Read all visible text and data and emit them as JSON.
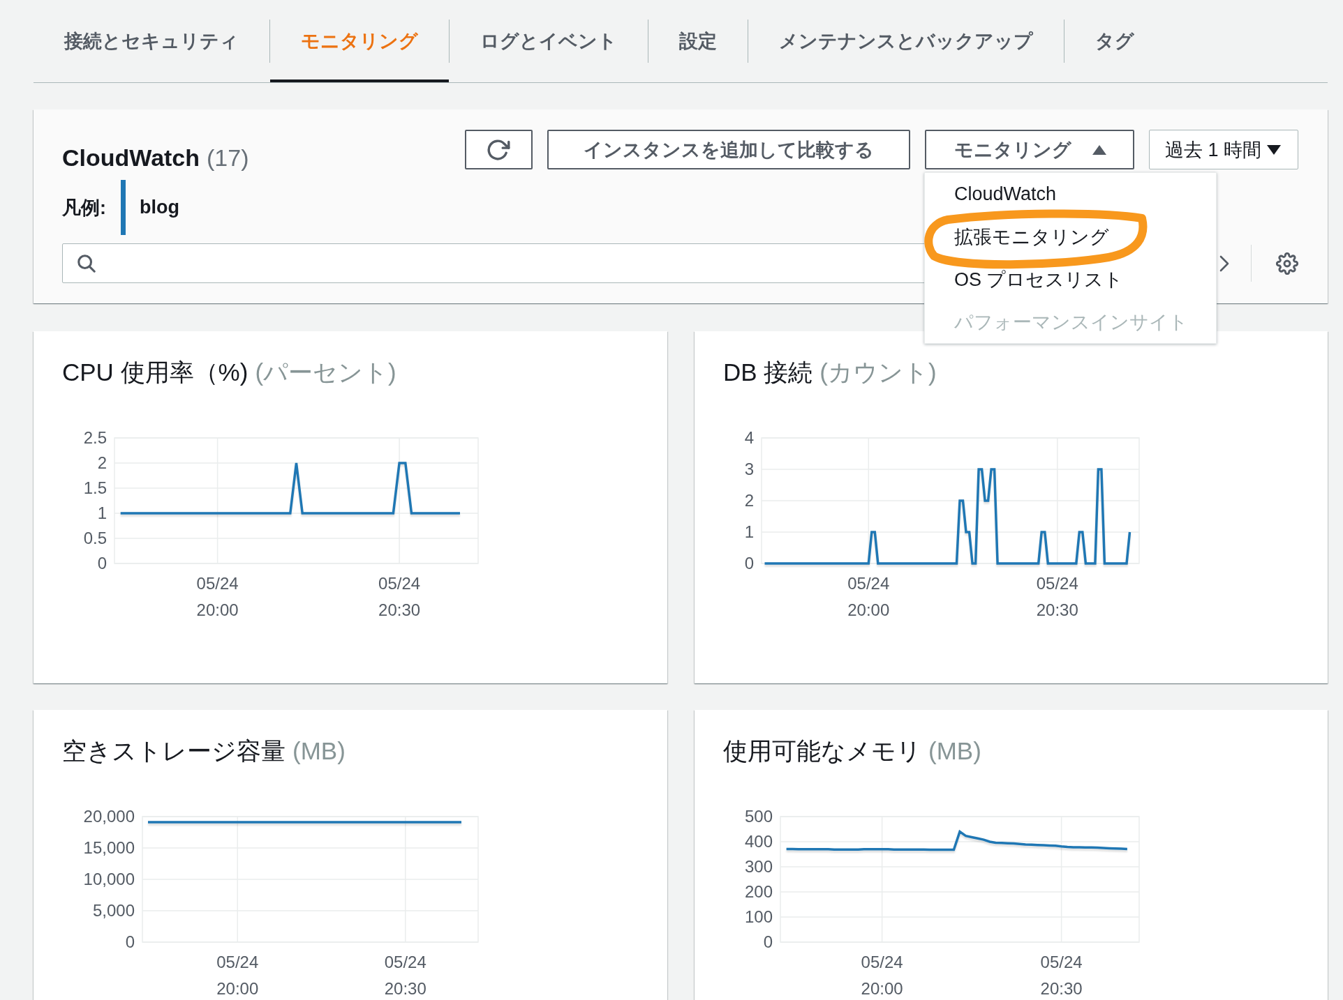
{
  "tabs": [
    {
      "label": "接続とセキュリティ",
      "selected": false
    },
    {
      "label": "モニタリング",
      "selected": true
    },
    {
      "label": "ログとイベント",
      "selected": false
    },
    {
      "label": "設定",
      "selected": false
    },
    {
      "label": "メンテナンスとバックアップ",
      "selected": false
    },
    {
      "label": "タグ",
      "selected": false
    }
  ],
  "cloudwatch_panel": {
    "title": "CloudWatch",
    "count": "(17)",
    "buttons": [
      {
        "kind": "refresh"
      },
      {
        "kind": "text",
        "label": "インスタンスを追加して比較する"
      },
      {
        "kind": "menu",
        "label": "モニタリング",
        "expanded": true,
        "items": [
          {
            "label": "CloudWatch",
            "highlighted": false,
            "disabled": false
          },
          {
            "label": "拡張モニタリング",
            "highlighted": true,
            "disabled": false
          },
          {
            "label": "OS プロセスリスト",
            "highlighted": false,
            "disabled": false
          },
          {
            "label": "パフォーマンスインサイト",
            "highlighted": false,
            "disabled": true
          }
        ]
      },
      {
        "kind": "select",
        "label": "過去 1 時間",
        "expanded": false
      }
    ],
    "legend": {
      "label": "凡例:",
      "items": [
        {
          "name": "blog",
          "color": "#1f77b4"
        }
      ]
    }
  },
  "charts": [
    {
      "title": "CPU 使用率（%)",
      "unit": "(パーセント)",
      "chart_data": {
        "type": "line",
        "grid": true,
        "categories": [
          null,
          null,
          null,
          null,
          null,
          null,
          null,
          null,
          null,
          null,
          null,
          null,
          null,
          null,
          null,
          null,
          null,
          "05/24 20:00",
          null,
          null,
          null,
          null,
          null,
          null,
          null,
          null,
          null,
          null,
          null,
          null,
          null,
          null,
          null,
          null,
          null,
          null,
          null,
          null,
          null,
          null,
          null,
          null,
          null,
          null,
          null,
          null,
          null,
          "05/24 20:30",
          null,
          null,
          null,
          null,
          null,
          null,
          null,
          null,
          null,
          null,
          null,
          null,
          null
        ],
        "series": [
          {
            "color": "#1f77b4",
            "values": [
              null,
              1,
              1,
              1,
              1,
              1,
              1,
              1,
              1,
              1,
              1,
              1,
              1,
              1,
              1,
              1,
              1,
              1,
              1,
              1,
              1,
              1,
              1,
              1,
              1,
              1,
              1,
              1,
              1,
              1,
              2,
              1,
              1,
              1,
              1,
              1,
              1,
              1,
              1,
              1,
              1,
              1,
              1,
              1,
              1,
              1,
              1,
              2,
              2,
              1,
              1,
              1,
              1,
              1,
              1,
              1,
              1,
              1,
              null,
              null,
              null
            ]
          }
        ],
        "ylim": [
          0,
          2.5
        ],
        "yticks": [
          0,
          0.5,
          1,
          1.5,
          2,
          2.5
        ]
      }
    },
    {
      "title": "DB 接続",
      "unit": "(カウント)",
      "chart_data": {
        "type": "line",
        "grid": true,
        "categories": [
          null,
          null,
          null,
          null,
          null,
          null,
          null,
          null,
          null,
          null,
          null,
          null,
          null,
          null,
          null,
          null,
          null,
          null,
          null,
          null,
          null,
          null,
          null,
          null,
          null,
          null,
          null,
          null,
          null,
          null,
          null,
          null,
          null,
          null,
          "05/24 20:00",
          null,
          null,
          null,
          null,
          null,
          null,
          null,
          null,
          null,
          null,
          null,
          null,
          null,
          null,
          null,
          null,
          null,
          null,
          null,
          null,
          null,
          null,
          null,
          null,
          null,
          null,
          null,
          null,
          null,
          null,
          null,
          null,
          null,
          null,
          null,
          null,
          null,
          null,
          null,
          null,
          null,
          null,
          null,
          null,
          null,
          null,
          null,
          null,
          null,
          null,
          null,
          null,
          null,
          null,
          null,
          null,
          null,
          null,
          null,
          "05/24 20:30",
          null,
          null,
          null,
          null,
          null,
          null,
          null,
          null,
          null,
          null,
          null,
          null,
          null,
          null,
          null,
          null,
          null,
          null,
          null,
          null,
          null,
          null,
          null,
          null,
          null,
          null
        ],
        "series": [
          {
            "color": "#1f77b4",
            "values": [
              null,
              0,
              0,
              0,
              0,
              0,
              0,
              0,
              0,
              0,
              0,
              0,
              0,
              0,
              0,
              0,
              0,
              0,
              0,
              0,
              0,
              0,
              0,
              0,
              0,
              0,
              0,
              0,
              0,
              0,
              0,
              0,
              0,
              0,
              0,
              1,
              1,
              0,
              0,
              0,
              0,
              0,
              0,
              0,
              0,
              0,
              0,
              0,
              0,
              0,
              0,
              0,
              0,
              0,
              0,
              0,
              0,
              0,
              0,
              0,
              0,
              0,
              0,
              2,
              2,
              1,
              1,
              0,
              0,
              3,
              3,
              2,
              2,
              3,
              3,
              0,
              0,
              0,
              0,
              0,
              0,
              0,
              0,
              0,
              0,
              0,
              0,
              0,
              0,
              1,
              1,
              0,
              0,
              0,
              0,
              0,
              0,
              0,
              0,
              0,
              0,
              1,
              1,
              0,
              0,
              0,
              0,
              3,
              3,
              0,
              0,
              0,
              0,
              0,
              0,
              0,
              0,
              1,
              null,
              null,
              null
            ]
          }
        ],
        "ylim": [
          0,
          4
        ],
        "yticks": [
          0,
          1,
          2,
          3,
          4
        ]
      }
    },
    {
      "title": "空きストレージ容量",
      "unit": "(MB)",
      "chart_data": {
        "type": "line",
        "grid": true,
        "categories": [
          null,
          null,
          null,
          null,
          null,
          null,
          null,
          null,
          null,
          null,
          null,
          null,
          null,
          null,
          null,
          null,
          null,
          "05/24 20:00",
          null,
          null,
          null,
          null,
          null,
          null,
          null,
          null,
          null,
          null,
          null,
          null,
          null,
          null,
          null,
          null,
          null,
          null,
          null,
          null,
          null,
          null,
          null,
          null,
          null,
          null,
          null,
          null,
          null,
          "05/24 20:30",
          null,
          null,
          null,
          null,
          null,
          null,
          null,
          null,
          null,
          null,
          null,
          null,
          null
        ],
        "series": [
          {
            "color": "#1f77b4",
            "values": [
              null,
              19100,
              19100,
              19100,
              19100,
              19100,
              19100,
              19100,
              19100,
              19100,
              19100,
              19100,
              19100,
              19100,
              19100,
              19100,
              19100,
              19100,
              19100,
              19100,
              19100,
              19100,
              19100,
              19100,
              19100,
              19100,
              19100,
              19100,
              19100,
              19100,
              19100,
              19100,
              19100,
              19100,
              19100,
              19100,
              19100,
              19100,
              19100,
              19100,
              19100,
              19100,
              19100,
              19100,
              19100,
              19100,
              19100,
              19100,
              19100,
              19100,
              19100,
              19100,
              19100,
              19100,
              19100,
              19100,
              19100,
              19100,
              null,
              null,
              null
            ]
          }
        ],
        "ylim": [
          0,
          20000
        ],
        "yticks": [
          {
            "value": 0,
            "label": "0"
          },
          {
            "value": 5000,
            "label": "5,000"
          },
          {
            "value": 10000,
            "label": "10,000"
          },
          {
            "value": 15000,
            "label": "15,000"
          },
          {
            "value": 20000,
            "label": "20,000"
          }
        ]
      }
    },
    {
      "title": "使用可能なメモリ",
      "unit": "(MB)",
      "chart_data": {
        "type": "line",
        "grid": true,
        "categories": [
          null,
          null,
          null,
          null,
          null,
          null,
          null,
          null,
          null,
          null,
          null,
          null,
          null,
          null,
          null,
          null,
          null,
          "05/24 20:00",
          null,
          null,
          null,
          null,
          null,
          null,
          null,
          null,
          null,
          null,
          null,
          null,
          null,
          null,
          null,
          null,
          null,
          null,
          null,
          null,
          null,
          null,
          null,
          null,
          null,
          null,
          null,
          null,
          null,
          "05/24 20:30",
          null,
          null,
          null,
          null,
          null,
          null,
          null,
          null,
          null,
          null,
          null,
          null,
          null
        ],
        "series": [
          {
            "color": "#1f77b4",
            "values": [
              null,
              371,
              371,
              370,
              370,
              370,
              370,
              370,
              370,
              369,
              369,
              369,
              369,
              369,
              370,
              370,
              370,
              370,
              370,
              369,
              369,
              369,
              369,
              369,
              369,
              368,
              368,
              368,
              368,
              368,
              440,
              423,
              418,
              413,
              408,
              400,
              396,
              395,
              394,
              393,
              391,
              389,
              388,
              387,
              386,
              385,
              384,
              381,
              379,
              378,
              378,
              377,
              377,
              376,
              375,
              374,
              373,
              372,
              371,
              null,
              null
            ]
          }
        ],
        "ylim": [
          0,
          500
        ],
        "yticks": [
          0,
          100,
          200,
          300,
          400,
          500
        ]
      }
    }
  ]
}
